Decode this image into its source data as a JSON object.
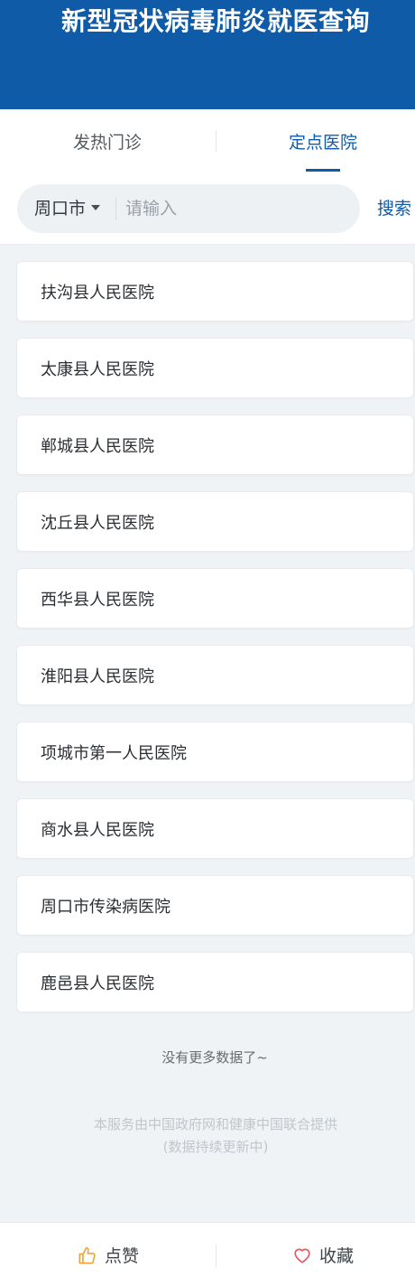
{
  "header": {
    "title": "新型冠状病毒肺炎就医查询",
    "background": "#0f5ba8"
  },
  "tabs": [
    {
      "label": "发热门诊",
      "active": false
    },
    {
      "label": "定点医院",
      "active": true
    }
  ],
  "search": {
    "city": "周口市",
    "placeholder": "请输入",
    "button_label": "搜索"
  },
  "hospitals": [
    "扶沟县人民医院",
    "太康县人民医院",
    "郸城县人民医院",
    "沈丘县人民医院",
    "西华县人民医院",
    "淮阳县人民医院",
    "项城市第一人民医院",
    "商水县人民医院",
    "周口市传染病医院",
    "鹿邑县人民医院"
  ],
  "list_end_text": "没有更多数据了~",
  "footer": {
    "line1": "本服务由中国政府网和健康中国联合提供",
    "line2": "(数据持续更新中)"
  },
  "bottom_bar": {
    "like_label": "点赞",
    "like_icon": "thumbs-up-icon",
    "like_color": "#f0a43a",
    "favorite_label": "收藏",
    "favorite_icon": "heart-icon",
    "favorite_color": "#e5585e"
  }
}
